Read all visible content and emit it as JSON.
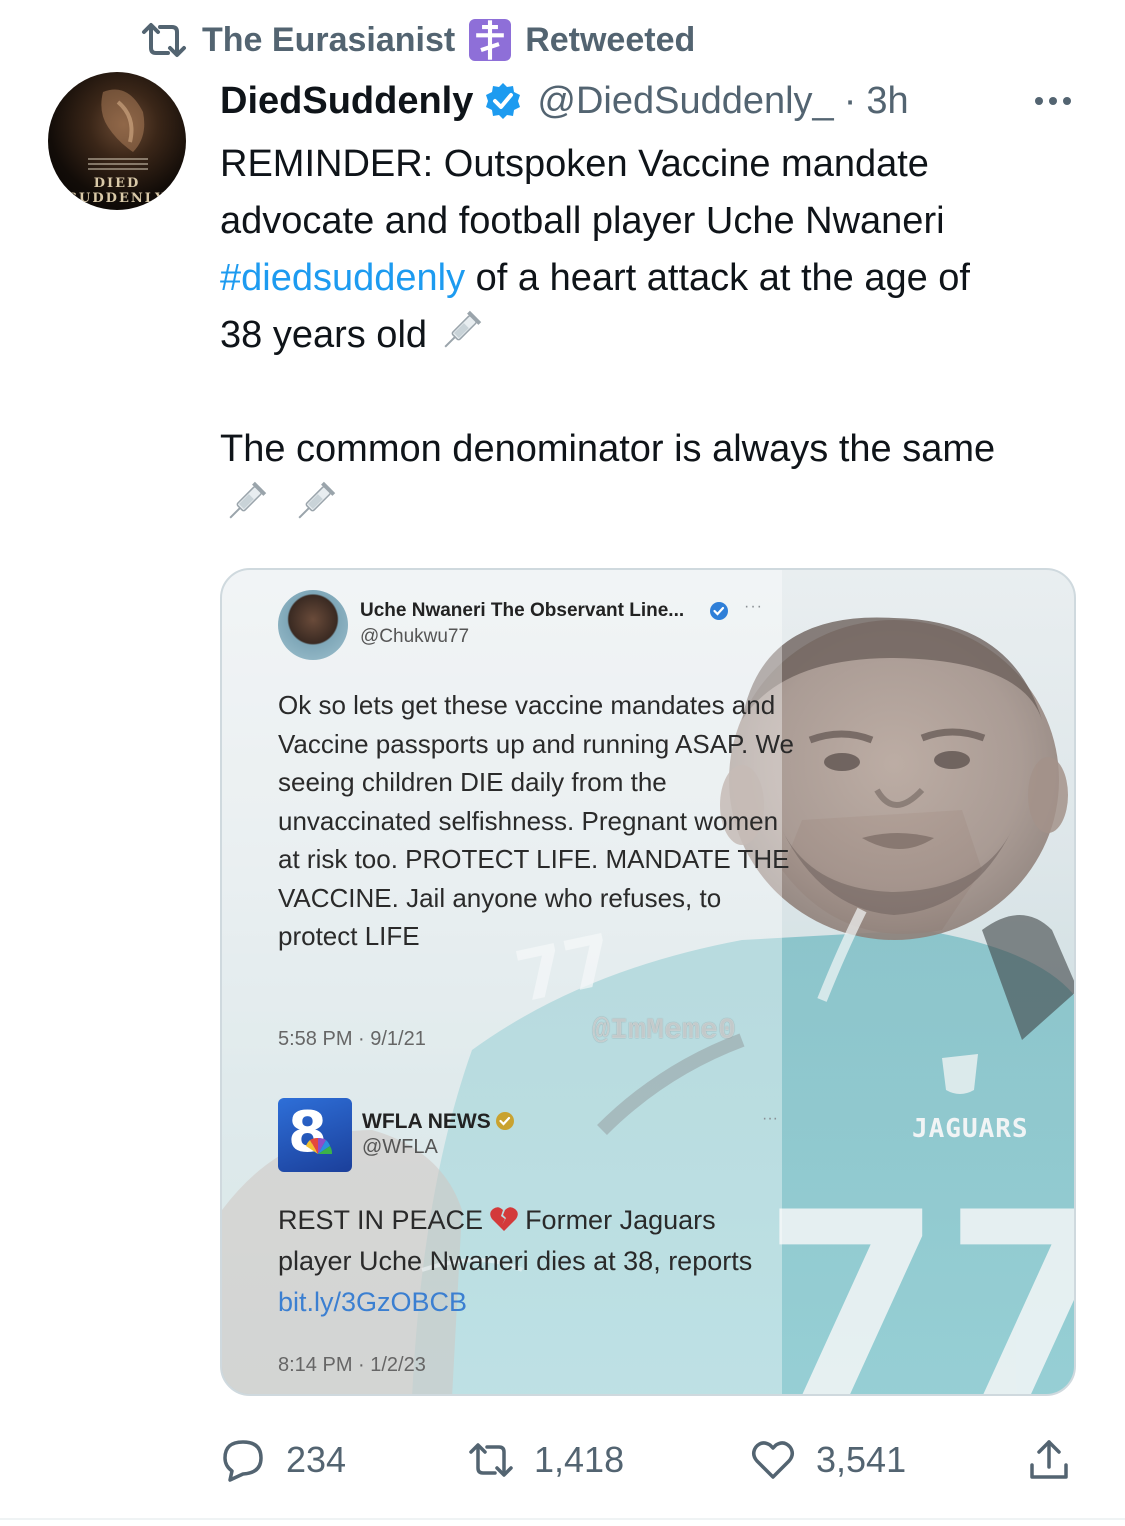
{
  "retweet": {
    "label_name": "The Eurasianist",
    "label_action": "Retweeted"
  },
  "tweet": {
    "display_name": "DiedSuddenly",
    "handle": "@DiedSuddenly_",
    "separator": "·",
    "time": "3h",
    "text_line1_a": "REMINDER: Outspoken Vaccine mandate",
    "text_line2": "advocate and football player Uche Nwaneri",
    "hashtag": "#diedsuddenly",
    "text_line3_b": " of a heart attack at the age of",
    "text_line4": "38 years old",
    "text_para2": "The common denominator is always the same",
    "avatar_text": "DIED SUDDENLY",
    "colors": {
      "accent": "#1d9bf0",
      "muted": "#536471",
      "text": "#0f1419"
    }
  },
  "media": {
    "quote": {
      "name": "Uche Nwaneri The Observant Line...",
      "handle": "@Chukwu77",
      "more": "···",
      "body": "Ok so lets get these vaccine mandates and Vaccine passports up and running ASAP. We seeing children DIE daily from the unvaccinated selfishness. Pregnant women at risk too. PROTECT LIFE. MANDATE THE VACCINE. Jail anyone who refuses, to protect LIFE",
      "time": "5:58 PM · 9/1/21"
    },
    "watermark": "@ImMeme0",
    "news": {
      "logo": "8",
      "name": "WFLA NEWS",
      "handle": "@WFLA",
      "more": "···",
      "body_a": "REST IN PEACE",
      "body_b": "Former Jaguars player Uche Nwaneri dies at 38, reports ",
      "link": "bit.ly/3GzOBCB",
      "time": "8:14 PM · 1/2/23"
    },
    "jersey": {
      "team": "JAGUARS",
      "shoulder_number": "77",
      "chest_number": "77"
    }
  },
  "actions": {
    "replies": "234",
    "retweets": "1,418",
    "likes": "3,541"
  }
}
